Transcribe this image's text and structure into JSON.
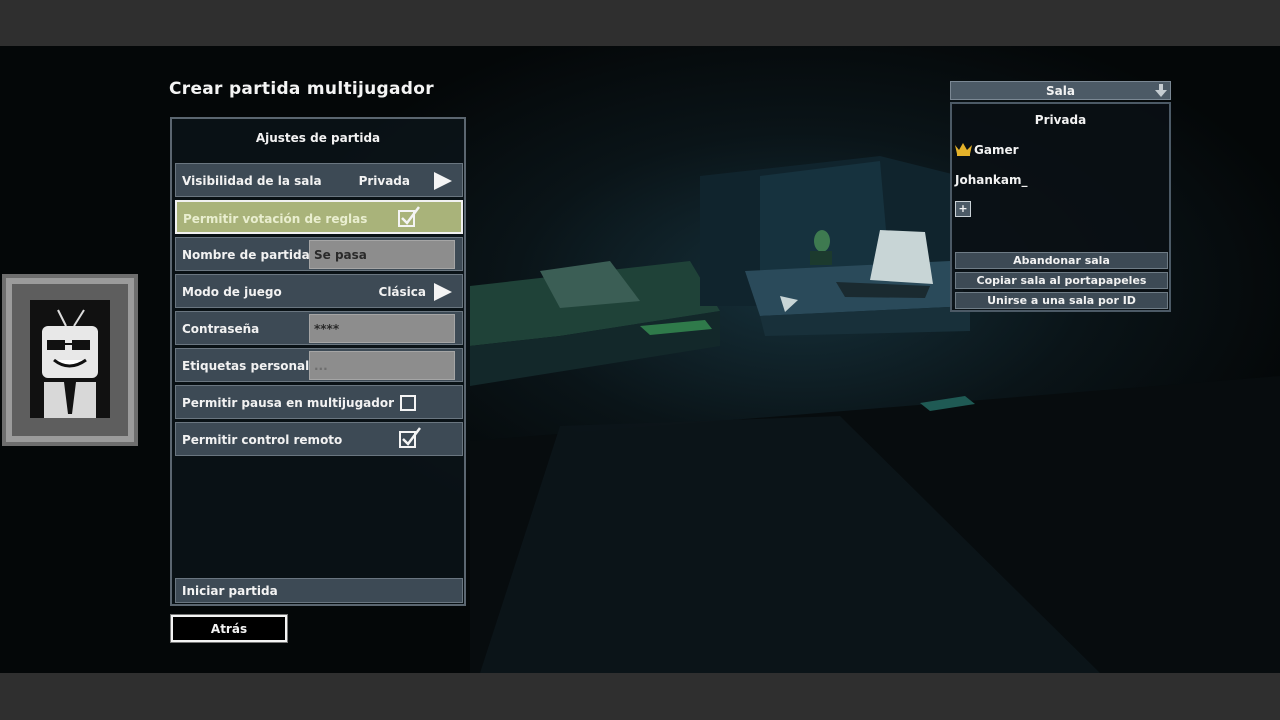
{
  "screen": {
    "title": "Crear partida multijugador"
  },
  "settings": {
    "heading": "Ajustes de partida",
    "visibility": {
      "label": "Visibilidad de la sala",
      "value": "Privada"
    },
    "rule_voting": {
      "label": "Permitir votación de reglas",
      "checked": true
    },
    "match_name": {
      "label": "Nombre de partida",
      "value": "Se pasa"
    },
    "game_mode": {
      "label": "Modo de juego",
      "value": "Clásica"
    },
    "password": {
      "label": "Contraseña",
      "value": "****"
    },
    "custom_tags": {
      "label": "Etiquetas personaliz.",
      "placeholder": "..."
    },
    "allow_pause": {
      "label": "Permitir pausa en multijugador",
      "checked": false
    },
    "remote_control": {
      "label": "Permitir control remoto",
      "checked": true
    },
    "start_label": "Iniciar partida"
  },
  "back_label": "Atrás",
  "room": {
    "header": "Sala",
    "privacy": "Privada",
    "players": [
      {
        "name": "Gamer",
        "host": true
      },
      {
        "name": "Johankam_",
        "host": false
      }
    ],
    "add_label": "+",
    "leave_label": "Abandonar sala",
    "copy_label": "Copiar sala al portapapeles",
    "join_label": "Unirse a una sala por ID"
  },
  "colors": {
    "row_bg": "#3d4a55",
    "highlight_bg": "#a9b37a",
    "field_bg": "#8d8d8d",
    "crown": "#e5b22a"
  }
}
